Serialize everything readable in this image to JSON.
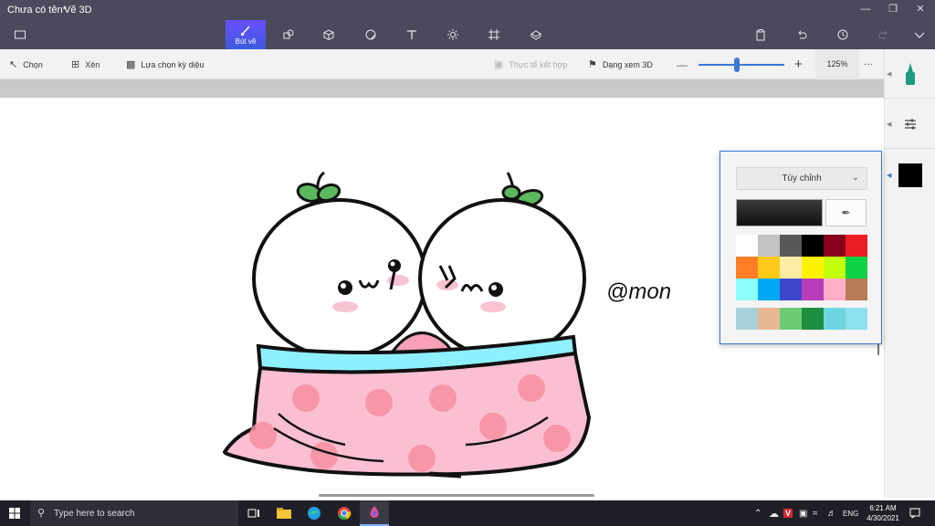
{
  "window": {
    "title": "Chưa có tên*",
    "app_name": "Vẽ 3D",
    "controls": [
      "minimize",
      "restore",
      "close"
    ]
  },
  "toolbar": {
    "active_tool_label": "Bút vẽ",
    "tools": [
      "menu-icon",
      "brush-icon",
      "shapes-2d-icon",
      "shapes-3d-icon",
      "sticker-icon",
      "text-icon",
      "effects-icon",
      "canvas-icon",
      "library-icon"
    ],
    "right_tools": [
      "paste-icon",
      "undo-icon",
      "history-icon",
      "redo-icon",
      "expand-icon"
    ]
  },
  "commandbar": {
    "select_label": "Chọn",
    "crop_label": "Xén",
    "magic_select_label": "Lựa chọn kỳ diệu",
    "mixed_reality_label": "Thực tế kết hợp",
    "view3d_label": "Dạng xem 3D",
    "zoom_value": "125%",
    "zoom_level": 0.45,
    "more_label": "···"
  },
  "canvas": {
    "signature_text": "@mon"
  },
  "color_popup": {
    "dropdown_label": "Tùy chỉnh",
    "current_color": "#1c1c1c",
    "palette": [
      "#ffffff",
      "#c3c3c3",
      "#585858",
      "#000000",
      "#88001b",
      "#ec1c24",
      "#ff7f27",
      "#ffca18",
      "#fdeca6",
      "#fff200",
      "#c4ff0e",
      "#0ed145",
      "#8cfffb",
      "#00a8f3",
      "#3f48cc",
      "#b83dba",
      "#ffaec8",
      "#b97a56"
    ],
    "custom_colors": [
      "#a6d1da",
      "#e6b893",
      "#6ccc74",
      "#1e8e3e",
      "#6dd6e0",
      "#8ee0ef"
    ]
  },
  "right_panel": {
    "selected_color": "#000000"
  },
  "taskbar": {
    "search_placeholder": "Type here to search",
    "language": "ENG",
    "time": "6:21 AM",
    "date": "4/30/2021"
  }
}
